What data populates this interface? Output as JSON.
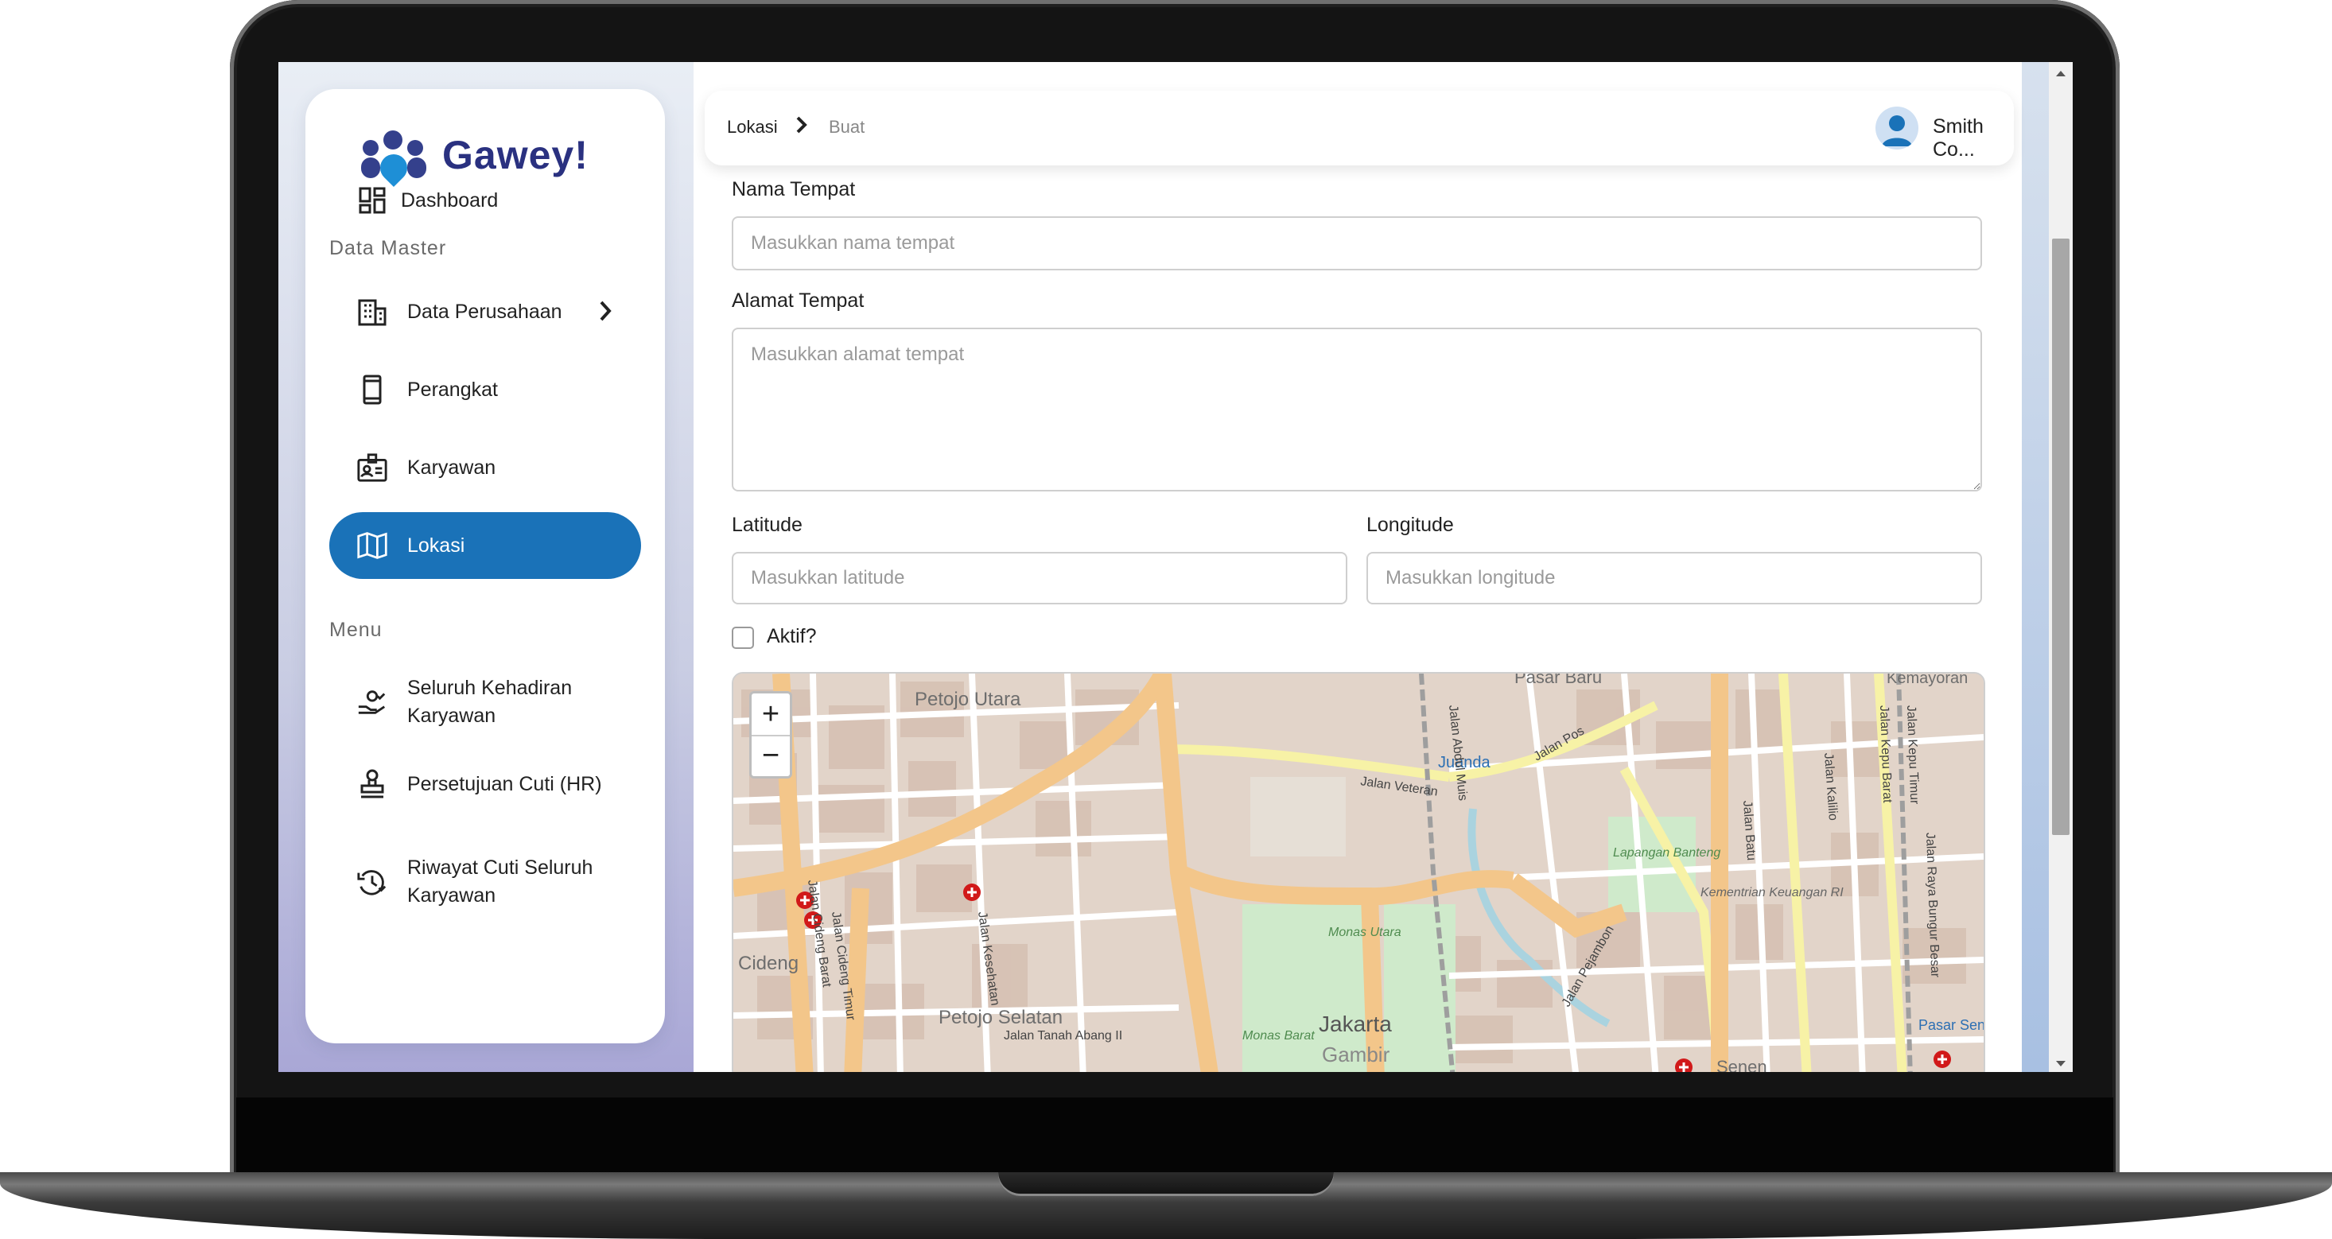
{
  "app": {
    "name": "Gawey!"
  },
  "sidebar": {
    "items": [
      {
        "label": "Dashboard",
        "icon": "dashboard-icon"
      },
      {
        "label": "Data Perusahaan",
        "icon": "building-icon",
        "has_submenu": true
      },
      {
        "label": "Perangkat",
        "icon": "device-icon"
      },
      {
        "label": "Karyawan",
        "icon": "employee-card-icon"
      },
      {
        "label": "Lokasi",
        "icon": "map-icon",
        "active": true
      },
      {
        "label": "Seluruh Kehadiran Karyawan",
        "icon": "attendance-icon"
      },
      {
        "label": "Persetujuan Cuti (HR)",
        "icon": "stamp-icon"
      },
      {
        "label": "Riwayat Cuti Seluruh Karyawan",
        "icon": "history-icon"
      }
    ],
    "sections": {
      "data_master": "Data Master",
      "menu": "Menu"
    }
  },
  "header": {
    "breadcrumb": [
      "Lokasi",
      "Buat"
    ],
    "user_name": "Smith Co..."
  },
  "form": {
    "name_label": "Nama Tempat",
    "name_placeholder": "Masukkan nama tempat",
    "address_label": "Alamat Tempat",
    "address_placeholder": "Masukkan alamat tempat",
    "latitude_label": "Latitude",
    "latitude_placeholder": "Masukkan latitude",
    "longitude_label": "Longitude",
    "longitude_placeholder": "Masukkan longitude",
    "active_label": "Aktif?",
    "active_checked": false
  },
  "map": {
    "zoom_in": "+",
    "zoom_out": "−",
    "labels": [
      "Petojo Utara",
      "Pasar Baru",
      "Kemayoran",
      "Juanda",
      "Jalan Veteran",
      "Jalan Pos",
      "Lapangan Banteng",
      "Monas Utara",
      "Monas Barat",
      "Jakarta",
      "Gambir",
      "Petojo Selatan",
      "Cideng",
      "Jalan Tanah Abang II",
      "Kementrian Keuangan RI",
      "Pasar Senen",
      "Senen",
      "Jalan Pejambon",
      "Jalan Cideng Barat",
      "Jalan Cideng Timur",
      "Jalan Kesehatan",
      "Jalan Kepu Barat",
      "Jalan Kepu Timur",
      "Jalan Abdul Muis",
      "Jalan Batu",
      "Jalan Kalilio",
      "Jalan Raya Bungur Besar"
    ]
  },
  "colors": {
    "accent": "#1a72b8",
    "brand": "#2a3180",
    "road_major": "#f4c98b",
    "road_secondary": "#f6f0a4",
    "park": "#cfeacb"
  }
}
